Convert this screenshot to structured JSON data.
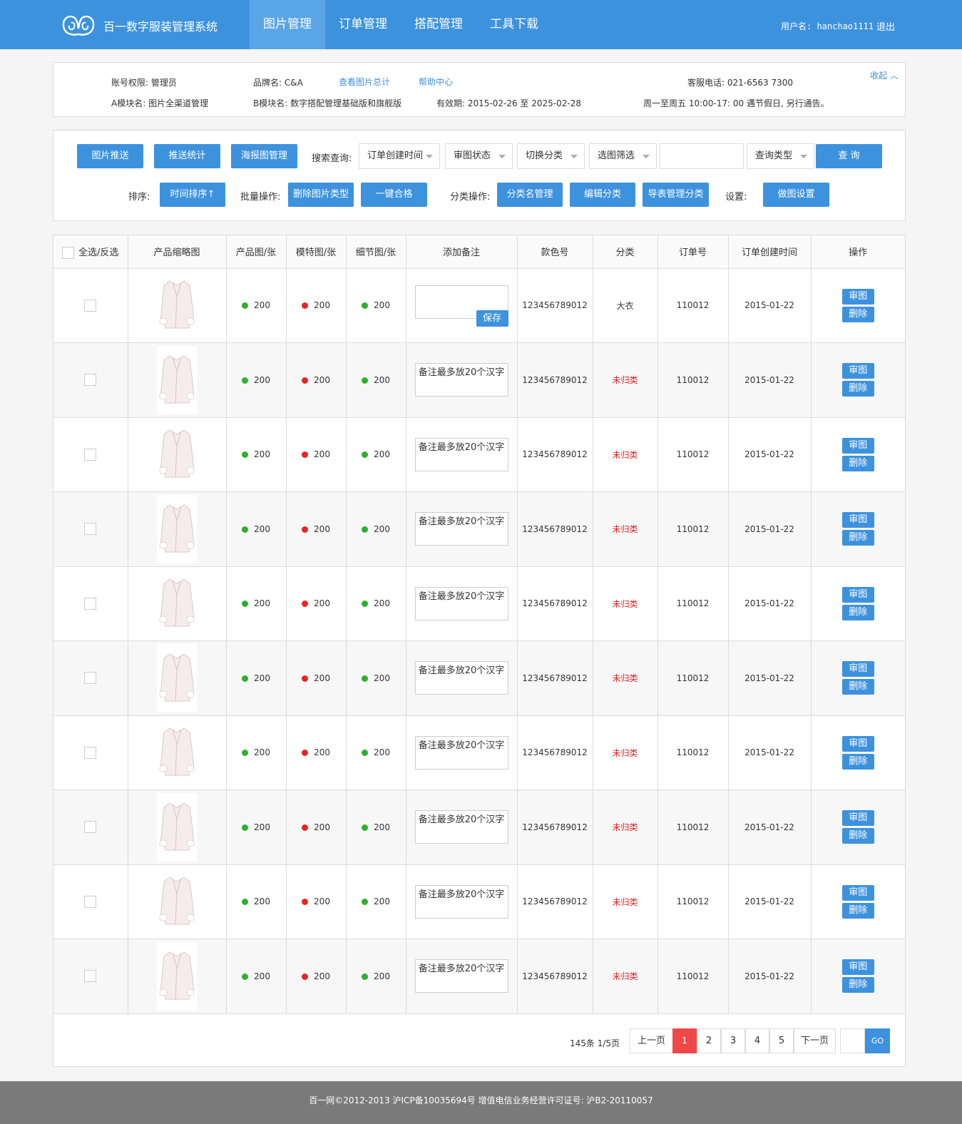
{
  "header": {
    "brand": "百一数字服装管理系统",
    "nav": [
      "图片管理",
      "订单管理",
      "搭配管理",
      "工具下载"
    ],
    "username": "用户名: hanchao1111",
    "logout": "退出"
  },
  "info": {
    "account": "账号权限: 管理员",
    "brand": "品牌名: C&A",
    "view_total": "查看图片总计",
    "help": "帮助中心",
    "phone": "客服电话: 021-6563 7300",
    "collapse": "收起",
    "module_a": "A模块名: 图片全渠道管理",
    "module_b": "B模块名: 数字搭配管理基础版和旗舰版",
    "validity": "有效期: 2015-02-26  至  2025-02-28",
    "hours": "周一至周五 10:00-17: 00  遇节假日, 另行通告。"
  },
  "toolbar": {
    "push": "图片推送",
    "stats": "推送统计",
    "poster": "海报图管理",
    "search_label": "搜索查询:",
    "sel_time": "订单创建时间",
    "sel_review": "审图状态",
    "sel_category": "切换分类",
    "sel_filter": "选图筛选",
    "sel_query_type": "查询类型",
    "query": "查  询",
    "sort_label": "排序:",
    "sort_time": "时间排序↑",
    "batch_label": "批量操作:",
    "delete_type": "删除图片类型",
    "one_pass": "一键合格",
    "cat_label": "分类操作:",
    "cat_name": "分类名管理",
    "edit_cat": "编辑分类",
    "export_cat": "导表管理分类",
    "settings_label": "设置:",
    "img_settings": "做图设置"
  },
  "table": {
    "headers": [
      "全选/反选",
      "产品缩略图",
      "产品图/张",
      "模特图/张",
      "细节图/张",
      "添加备注",
      "款色号",
      "分类",
      "订单号",
      "订单创建时间",
      "操作"
    ],
    "save_label": "保存",
    "review_label": "审图",
    "delete_label": "删除",
    "rows": [
      {
        "product": "200",
        "model": "200",
        "detail": "200",
        "note": "",
        "sku": "123456789012",
        "category": "大衣",
        "uncategorized": false,
        "order": "110012",
        "date": "2015-01-22"
      },
      {
        "product": "200",
        "model": "200",
        "detail": "200",
        "note": "备注最多放20个汉字",
        "sku": "123456789012",
        "category": "未归类",
        "uncategorized": true,
        "order": "110012",
        "date": "2015-01-22"
      },
      {
        "product": "200",
        "model": "200",
        "detail": "200",
        "note": "备注最多放20个汉字",
        "sku": "123456789012",
        "category": "未归类",
        "uncategorized": true,
        "order": "110012",
        "date": "2015-01-22"
      },
      {
        "product": "200",
        "model": "200",
        "detail": "200",
        "note": "备注最多放20个汉字",
        "sku": "123456789012",
        "category": "未归类",
        "uncategorized": true,
        "order": "110012",
        "date": "2015-01-22"
      },
      {
        "product": "200",
        "model": "200",
        "detail": "200",
        "note": "备注最多放20个汉字",
        "sku": "123456789012",
        "category": "未归类",
        "uncategorized": true,
        "order": "110012",
        "date": "2015-01-22"
      },
      {
        "product": "200",
        "model": "200",
        "detail": "200",
        "note": "备注最多放20个汉字",
        "sku": "123456789012",
        "category": "未归类",
        "uncategorized": true,
        "order": "110012",
        "date": "2015-01-22"
      },
      {
        "product": "200",
        "model": "200",
        "detail": "200",
        "note": "备注最多放20个汉字",
        "sku": "123456789012",
        "category": "未归类",
        "uncategorized": true,
        "order": "110012",
        "date": "2015-01-22"
      },
      {
        "product": "200",
        "model": "200",
        "detail": "200",
        "note": "备注最多放20个汉字",
        "sku": "123456789012",
        "category": "未归类",
        "uncategorized": true,
        "order": "110012",
        "date": "2015-01-22"
      },
      {
        "product": "200",
        "model": "200",
        "detail": "200",
        "note": "备注最多放20个汉字",
        "sku": "123456789012",
        "category": "未归类",
        "uncategorized": true,
        "order": "110012",
        "date": "2015-01-22"
      },
      {
        "product": "200",
        "model": "200",
        "detail": "200",
        "note": "备注最多放20个汉字",
        "sku": "123456789012",
        "category": "未归类",
        "uncategorized": true,
        "order": "110012",
        "date": "2015-01-22"
      }
    ]
  },
  "pager": {
    "total": "145条 1/5页",
    "prev": "上一页",
    "pages": [
      "1",
      "2",
      "3",
      "4",
      "5"
    ],
    "current": "1",
    "next": "下一页",
    "go": "GO"
  },
  "footer": {
    "text": "百一网©2012-2013  沪ICP备10035694号  增值电信业务经营许可证号: 沪B2-20110057"
  },
  "colors": {
    "primary": "#3d92de",
    "danger": "#e52424",
    "ok": "#2db02d"
  }
}
